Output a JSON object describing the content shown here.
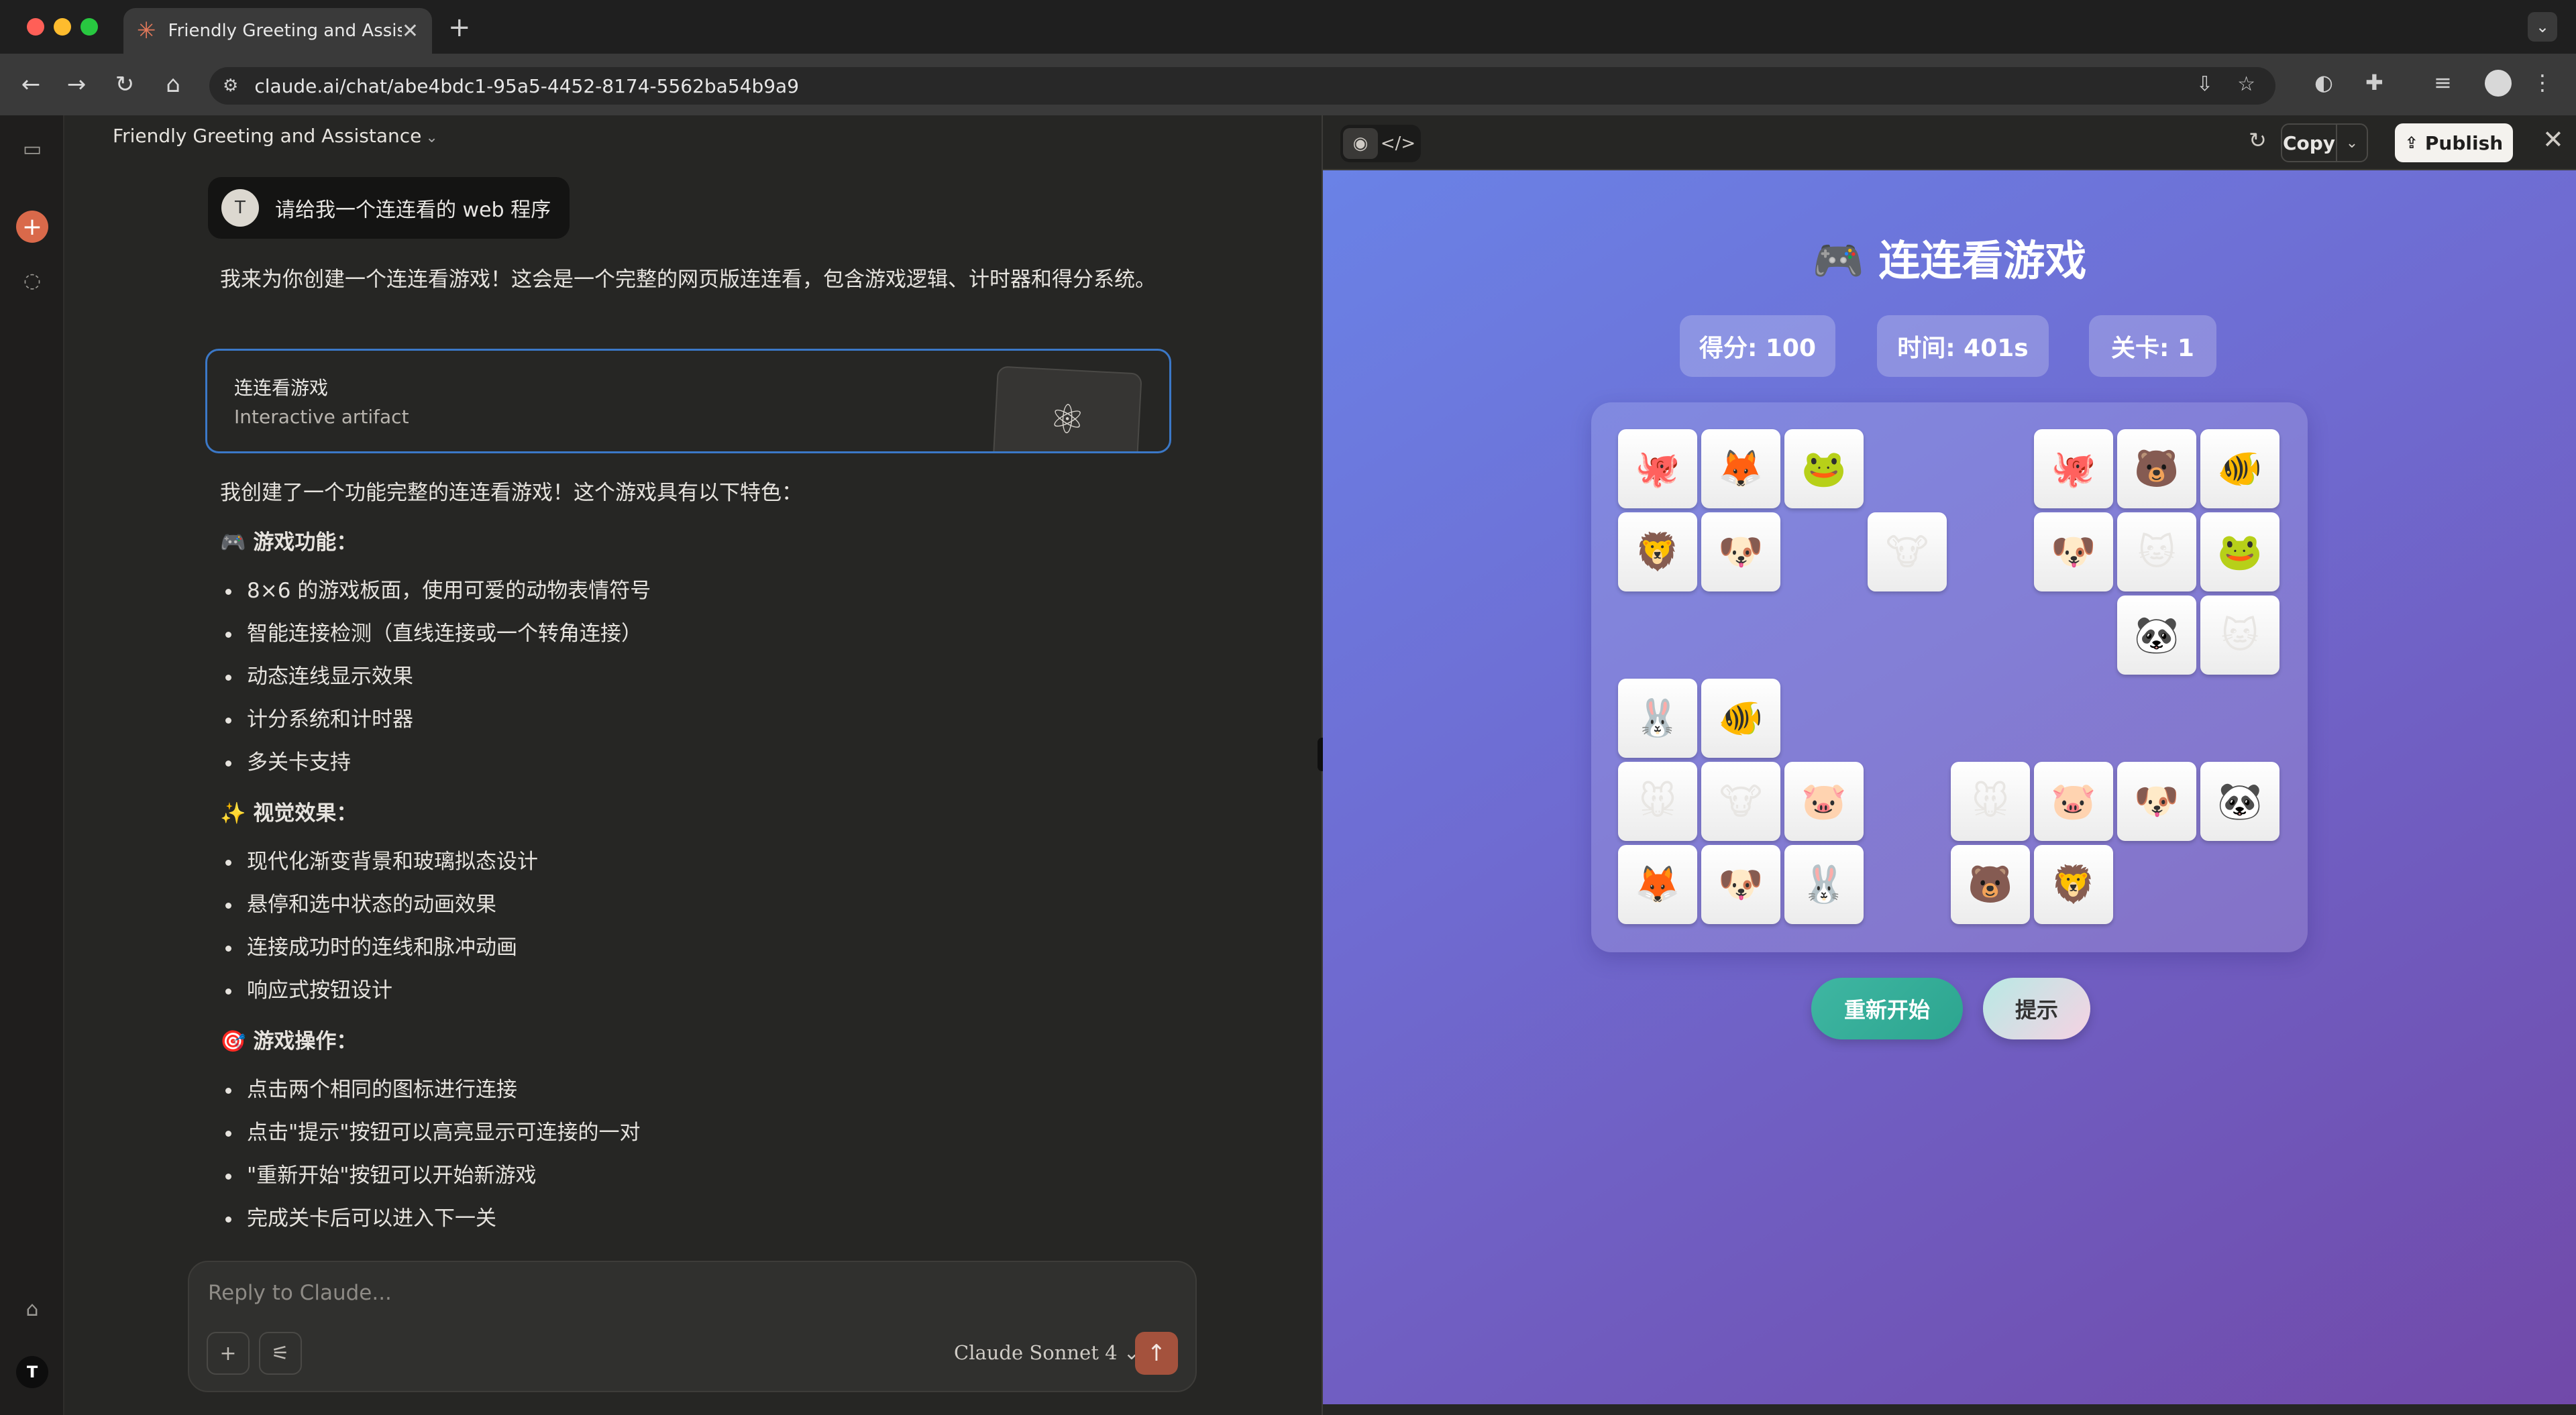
{
  "browser": {
    "tab_title": "Friendly Greeting and Assistance",
    "url": "claude.ai/chat/abe4bdc1-95a5-4452-8174-5562ba54b9a9",
    "icons": [
      "back-icon",
      "forward-icon",
      "reload-icon",
      "home-icon",
      "site-settings-icon",
      "install-icon",
      "star-icon"
    ]
  },
  "chat": {
    "title": "Friendly Greeting and Assistance",
    "user_avatar": "T",
    "user_message": "请给我一个连连看的 web 程序",
    "intro": "我来为你创建一个连连看游戏！这会是一个完整的网页版连连看，包含游戏逻辑、计时器和得分系统。",
    "artifact": {
      "title": "连连看游戏",
      "subtitle": "Interactive artifact"
    },
    "summary": "我创建了一个功能完整的连连看游戏！这个游戏具有以下特色：",
    "sections": [
      {
        "heading": "🎮 游戏功能：",
        "items": [
          "8×6 的游戏板面，使用可爱的动物表情符号",
          "智能连接检测（直线连接或一个转角连接）",
          "动态连线显示效果",
          "计分系统和计时器",
          "多关卡支持"
        ]
      },
      {
        "heading": "✨ 视觉效果：",
        "items": [
          "现代化渐变背景和玻璃拟态设计",
          "悬停和选中状态的动画效果",
          "连接成功时的连线和脉冲动画",
          "响应式按钮设计"
        ]
      },
      {
        "heading": "🎯 游戏操作：",
        "items": [
          "点击两个相同的图标进行连接",
          "点击\"提示\"按钮可以高亮显示可连接的一对",
          "\"重新开始\"按钮可以开始新游戏",
          "完成关卡后可以进入下一关"
        ]
      }
    ],
    "reply_placeholder": "Reply to Claude...",
    "model": "Claude Sonnet 4",
    "sidebar_avatar": "T"
  },
  "panel": {
    "copy_label": "Copy",
    "publish_label": "Publish"
  },
  "game": {
    "title": "🎮 连连看游戏",
    "score": "得分: 100",
    "time": "时间: 401s",
    "level": "关卡: 1",
    "restart_label": "重新开始",
    "hint_label": "提示",
    "board": [
      [
        "🐙",
        "🦊",
        "🐸",
        "",
        "",
        "🐙",
        "🐻",
        "🐠"
      ],
      [
        "🦁",
        "🐶",
        "",
        "🐮",
        "",
        "🐶",
        "🐱",
        "🐸"
      ],
      [
        "",
        "",
        "",
        "",
        "",
        "",
        "🐼",
        "🐱"
      ],
      [
        "🐰",
        "🐠",
        "",
        "",
        "",
        "",
        "",
        ""
      ],
      [
        "🐭",
        "🐮",
        "🐷",
        "",
        "🐭",
        "🐷",
        "🐶",
        "🐼"
      ],
      [
        "🦊",
        "🐶",
        "🐰",
        "",
        "🐻",
        "🦁",
        "",
        ""
      ]
    ]
  }
}
